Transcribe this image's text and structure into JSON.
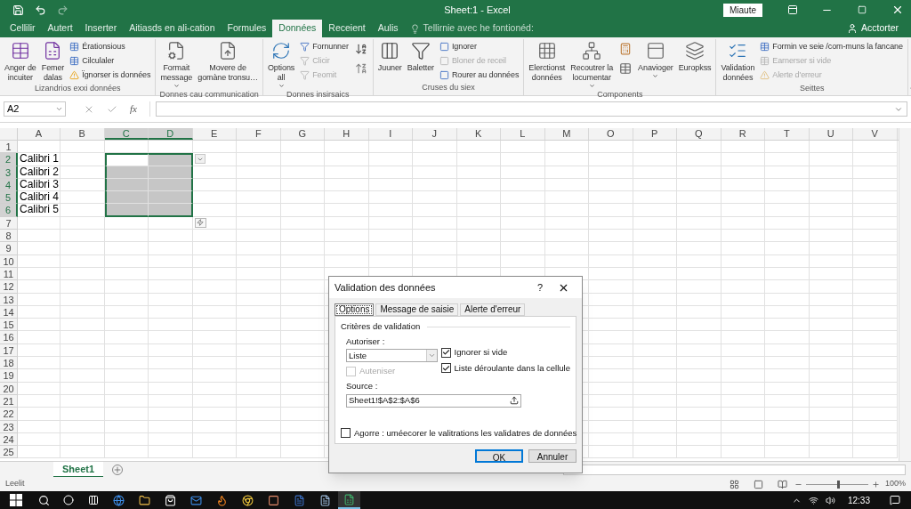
{
  "window": {
    "title": "Sheet:1 - Excel",
    "sign_in": "Miaute"
  },
  "tabs": [
    {
      "label": "Cellilir",
      "selected": false
    },
    {
      "label": "Autert",
      "selected": false
    },
    {
      "label": "Inserter",
      "selected": false
    },
    {
      "label": "Aitiasds en ali-cation",
      "selected": false
    },
    {
      "label": "Formules",
      "selected": false
    },
    {
      "label": "Données",
      "selected": true
    },
    {
      "label": "Receient",
      "selected": false
    },
    {
      "label": "Aulis",
      "selected": false
    }
  ],
  "tell_me": "Tellirnie avec he fontionéd:",
  "account": "Acctorter",
  "ribbon": [
    {
      "label": "Lizandrios exxi données",
      "items": [
        {
          "kind": "large",
          "lines": [
            "Anger de",
            "incuiter"
          ],
          "dropdown": false,
          "disabled": false
        },
        {
          "kind": "large",
          "lines": [
            "Femer",
            "dalas"
          ],
          "dropdown": false,
          "disabled": false
        },
        {
          "kind": "stack",
          "items": [
            {
              "label": "Érationsious",
              "disabled": false
            },
            {
              "label": "Cilculaler",
              "disabled": false
            },
            {
              "label": "Ïgnorser is données",
              "disabled": false
            }
          ]
        }
      ]
    },
    {
      "label": "Donnes cau communication",
      "items": [
        {
          "kind": "large",
          "lines": [
            "Formait",
            "message"
          ],
          "dropdown": true,
          "disabled": false
        },
        {
          "kind": "large",
          "lines": [
            "Movere de",
            "gomàne tronsu…"
          ],
          "dropdown": false,
          "disabled": false
        }
      ]
    },
    {
      "label": "Donnes insirsaics",
      "items": [
        {
          "kind": "large",
          "lines": [
            "Options",
            "all"
          ],
          "dropdown": true,
          "disabled": false
        },
        {
          "kind": "stack",
          "items": [
            {
              "label": "Fornunner",
              "disabled": false
            },
            {
              "label": "Clicir",
              "disabled": true
            },
            {
              "label": "Feomit",
              "disabled": true
            }
          ]
        },
        {
          "kind": "sort"
        }
      ]
    },
    {
      "label": "Cruses du siex",
      "items": [
        {
          "kind": "large",
          "lines": [
            "Juuner"
          ],
          "dropdown": false,
          "disabled": false
        },
        {
          "kind": "large",
          "lines": [
            "Baletter"
          ],
          "dropdown": false,
          "disabled": false
        },
        {
          "kind": "stack",
          "items": [
            {
              "label": "Ignorer",
              "disabled": false
            },
            {
              "label": "Bloner de receil",
              "disabled": true
            },
            {
              "label": "Rourer au données",
              "disabled": false
            }
          ]
        }
      ]
    },
    {
      "label": "Components",
      "items": [
        {
          "kind": "large",
          "lines": [
            "Elerctionst",
            "données"
          ],
          "dropdown": false,
          "disabled": false
        },
        {
          "kind": "large",
          "lines": [
            "Recoutrer la",
            "locumentar"
          ],
          "dropdown": true,
          "disabled": false
        },
        {
          "kind": "icons"
        },
        {
          "kind": "large",
          "lines": [
            "Anavioger"
          ],
          "dropdown": true,
          "disabled": false
        },
        {
          "kind": "large",
          "lines": [
            "Europkss"
          ],
          "dropdown": false,
          "disabled": false
        }
      ]
    },
    {
      "label": "Seittes",
      "items": [
        {
          "kind": "large",
          "lines": [
            "Validation",
            "données"
          ],
          "dropdown": false,
          "disabled": false
        },
        {
          "kind": "stack",
          "items": [
            {
              "label": "Formin ve seie /com-muns la fancane",
              "disabled": false
            },
            {
              "label": "Earnerser si vide",
              "disabled": true
            },
            {
              "label": "Alerte d'erreur",
              "disabled": true
            }
          ]
        }
      ]
    }
  ],
  "formula_bar": {
    "name_box": "A2",
    "function_label": "fx"
  },
  "grid": {
    "columns": [
      {
        "label": "A",
        "selected": false
      },
      {
        "label": "B",
        "selected": false
      },
      {
        "label": "C",
        "selected": true
      },
      {
        "label": "D",
        "selected": true
      },
      {
        "label": "E",
        "selected": false
      },
      {
        "label": "F",
        "selected": false
      },
      {
        "label": "G",
        "selected": false
      },
      {
        "label": "H",
        "selected": false
      },
      {
        "label": "I",
        "selected": false
      },
      {
        "label": "J",
        "selected": false
      },
      {
        "label": "K",
        "selected": false
      },
      {
        "label": "L",
        "selected": false
      },
      {
        "label": "M",
        "selected": false
      },
      {
        "label": "O",
        "selected": false
      },
      {
        "label": "P",
        "selected": false
      },
      {
        "label": "Q",
        "selected": false
      },
      {
        "label": "R",
        "selected": false
      },
      {
        "label": "T",
        "selected": false
      },
      {
        "label": "U",
        "selected": false
      },
      {
        "label": "V",
        "selected": false
      }
    ],
    "rows": [
      {
        "label": "1",
        "selected": false,
        "cells": []
      },
      {
        "label": "2",
        "selected": true,
        "cells": [
          "Calibri 1"
        ]
      },
      {
        "label": "3",
        "selected": true,
        "cells": [
          "Calibri 2"
        ]
      },
      {
        "label": "4",
        "selected": true,
        "cells": [
          "Calibri 3"
        ]
      },
      {
        "label": "5",
        "selected": true,
        "cells": [
          "Calibri 4"
        ]
      },
      {
        "label": "6",
        "selected": true,
        "cells": [
          "Calibri 5"
        ]
      },
      {
        "label": "7",
        "selected": false,
        "cells": []
      },
      {
        "label": "8",
        "selected": false,
        "cells": []
      },
      {
        "label": "9",
        "selected": false,
        "cells": []
      },
      {
        "label": "10",
        "selected": false,
        "cells": []
      },
      {
        "label": "11",
        "selected": false,
        "cells": []
      },
      {
        "label": "12",
        "selected": false,
        "cells": []
      },
      {
        "label": "13",
        "selected": false,
        "cells": []
      },
      {
        "label": "14",
        "selected": false,
        "cells": []
      },
      {
        "label": "15",
        "selected": false,
        "cells": []
      },
      {
        "label": "16",
        "selected": false,
        "cells": []
      },
      {
        "label": "17",
        "selected": false,
        "cells": []
      },
      {
        "label": "18",
        "selected": false,
        "cells": []
      },
      {
        "label": "19",
        "selected": false,
        "cells": []
      },
      {
        "label": "20",
        "selected": false,
        "cells": []
      },
      {
        "label": "21",
        "selected": false,
        "cells": []
      },
      {
        "label": "22",
        "selected": false,
        "cells": []
      },
      {
        "label": "23",
        "selected": false,
        "cells": []
      },
      {
        "label": "24",
        "selected": false,
        "cells": []
      },
      {
        "label": "25",
        "selected": false,
        "cells": []
      }
    ]
  },
  "dialog": {
    "title": "Validation des données",
    "help": "?",
    "tabs": [
      {
        "label": "Options",
        "selected": true
      },
      {
        "label": "Message de saisie",
        "selected": false
      },
      {
        "label": "Alerte d'erreur",
        "selected": false
      }
    ],
    "section": "Critères de validation",
    "allow_label": "Autoriser :",
    "allow_value": "Liste",
    "sub_option": {
      "label": "Auteniser",
      "checked": false,
      "disabled": true
    },
    "options": [
      {
        "label": "Ignorer si vide",
        "checked": true
      },
      {
        "label": "Liste déroulante dans la cellule",
        "checked": true
      }
    ],
    "source_label": "Source :",
    "source_value": "Sheet1!$A$2:$A$6",
    "apply_all": {
      "label": "Agorre : uméecorer le valitrations les validatres de données",
      "checked": false
    },
    "buttons": [
      {
        "label": "OK",
        "default": true
      },
      {
        "label": "Annuler",
        "default": false
      }
    ]
  },
  "sheets": [
    {
      "label": "Sheet1",
      "selected": true
    }
  ],
  "status_bar": {
    "text": "Leelit",
    "zoom": "100%",
    "zoom_slider": {
      "level": 0.5
    }
  },
  "taskbar": {
    "time": "12:33"
  }
}
